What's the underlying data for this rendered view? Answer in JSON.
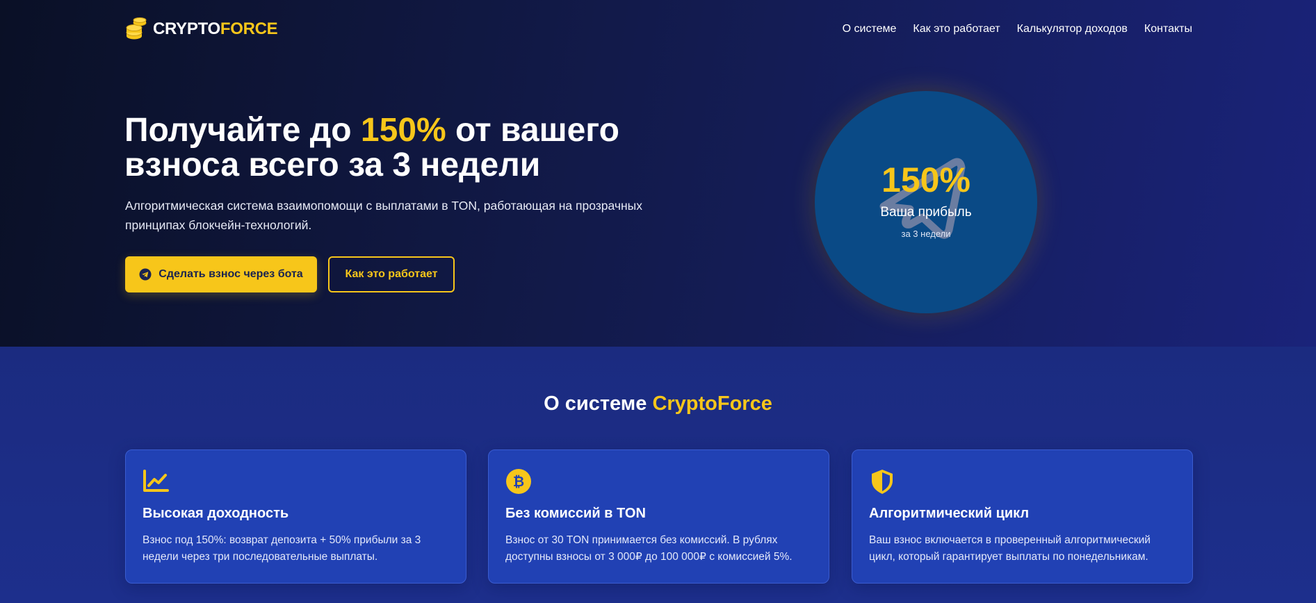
{
  "brand": {
    "name_part1": "CRYPTO",
    "name_part2": "FORCE"
  },
  "nav": {
    "items": [
      {
        "label": "О системе"
      },
      {
        "label": "Как это работает"
      },
      {
        "label": "Калькулятор доходов"
      },
      {
        "label": "Контакты"
      }
    ]
  },
  "hero": {
    "title_before": "Получайте до ",
    "title_highlight": "150%",
    "title_after": " от вашего взноса всего за 3 недели",
    "description": "Алгоритмическая система взаимопомощи с выплатами в TON, работающая на прозрачных принципах блокчейн-технологий.",
    "primary_button": "Сделать взнос через бота",
    "secondary_button": "Как это работает",
    "circle": {
      "percent": "150%",
      "label": "Ваша прибыль",
      "sublabel": "за 3 недели"
    }
  },
  "about": {
    "title_before": "О системе ",
    "title_highlight": "CryptoForce",
    "cards": [
      {
        "icon": "chart-line-icon",
        "title": "Высокая доходность",
        "text": "Взнос под 150%: возврат депозита + 50% прибыли за 3 недели через три последовательные выплаты."
      },
      {
        "icon": "bitcoin-icon",
        "title": "Без комиссий в TON",
        "text": "Взнос от 30 TON принимается без комиссий. В рублях доступны взносы от 3 000₽ до 100 000₽ с комиссией 5%."
      },
      {
        "icon": "shield-icon",
        "title": "Алгоритмический цикл",
        "text": "Ваш взнос включается в проверенный алгоритмический цикл, который гарантирует выплаты по понедельникам."
      }
    ]
  },
  "colors": {
    "accent": "#f7c61a",
    "hero_bg": "#121a4a",
    "section_bg": "#1d2f8c",
    "card_bg": "#2141b4",
    "circle_bg": "#0a4a86"
  }
}
